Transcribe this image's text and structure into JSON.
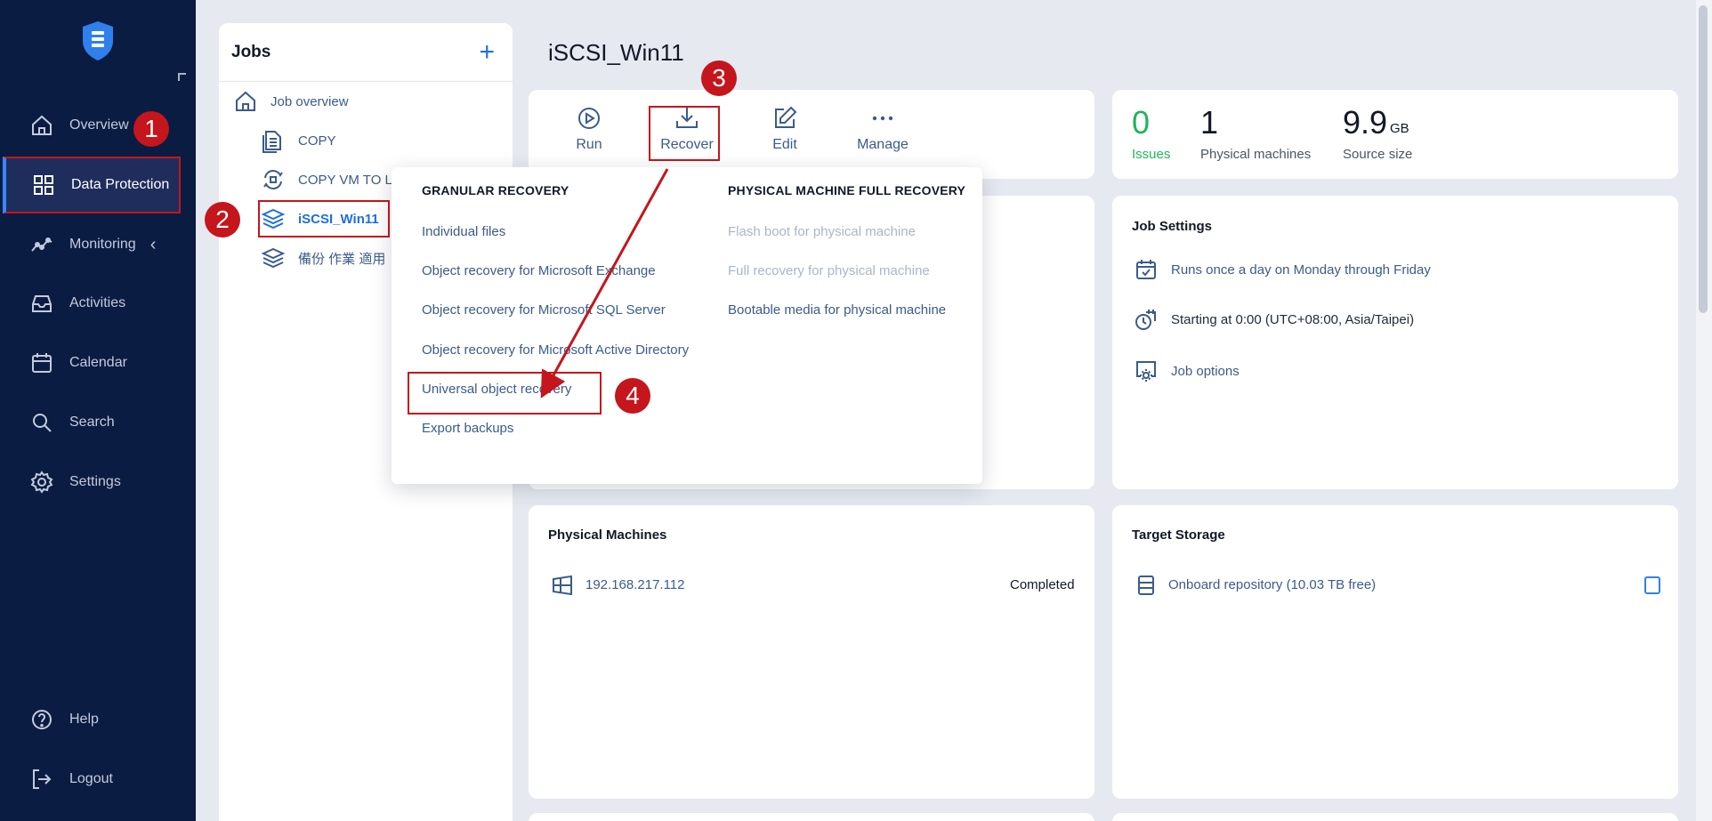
{
  "sidebar": {
    "items": [
      {
        "label": "Overview",
        "icon": "home-icon"
      },
      {
        "label": "Data Protection",
        "icon": "grid-icon"
      },
      {
        "label": "Monitoring",
        "icon": "chart-line-icon"
      },
      {
        "label": "Activities",
        "icon": "inbox-icon"
      },
      {
        "label": "Calendar",
        "icon": "calendar-icon"
      },
      {
        "label": "Search",
        "icon": "search-icon"
      },
      {
        "label": "Settings",
        "icon": "gear-icon"
      }
    ],
    "help": "Help",
    "logout": "Logout"
  },
  "jobs": {
    "title": "Jobs",
    "add": "+",
    "items": [
      {
        "label": "Job overview"
      },
      {
        "label": "COPY"
      },
      {
        "label": "COPY VM TO L"
      },
      {
        "label": "iSCSI_Win11"
      },
      {
        "label": "備份 作業 適用"
      }
    ]
  },
  "main": {
    "title": "iSCSI_Win11",
    "toolbar": {
      "run": "Run",
      "recover": "Recover",
      "edit": "Edit",
      "manage": "Manage"
    },
    "stats": {
      "issues_value": "0",
      "issues_label": "Issues",
      "machines_value": "1",
      "machines_label": "Physical machines",
      "size_value": "9.9",
      "size_unit": "GB",
      "size_label": "Source size"
    },
    "job_settings": {
      "title": "Job Settings",
      "schedule": "Runs once a day on Monday through Friday",
      "start": "Starting at 0:00 (UTC+08:00, Asia/Taipei)",
      "options": "Job options"
    },
    "physical_machines": {
      "title": "Physical Machines",
      "machine": "192.168.217.112",
      "status": "Completed"
    },
    "target_storage": {
      "title": "Target Storage",
      "repo": "Onboard repository (10.03 TB free)"
    }
  },
  "dropdown": {
    "granular_head": "GRANULAR RECOVERY",
    "granular": [
      "Individual files",
      "Object recovery for Microsoft Exchange",
      "Object recovery for Microsoft SQL Server",
      "Object recovery for Microsoft Active Directory",
      "Universal object recovery",
      "Export backups"
    ],
    "physical_head": "PHYSICAL MACHINE FULL RECOVERY",
    "physical": [
      "Flash boot for physical machine",
      "Full recovery for physical machine",
      "Bootable media for physical machine"
    ]
  },
  "callouts": [
    "1",
    "2",
    "3",
    "4"
  ],
  "colors": {
    "sidebar_bg": "#0b1c43",
    "accent": "#1f6fe0",
    "callout": "#c4161c",
    "issues_green": "#22b35e"
  }
}
